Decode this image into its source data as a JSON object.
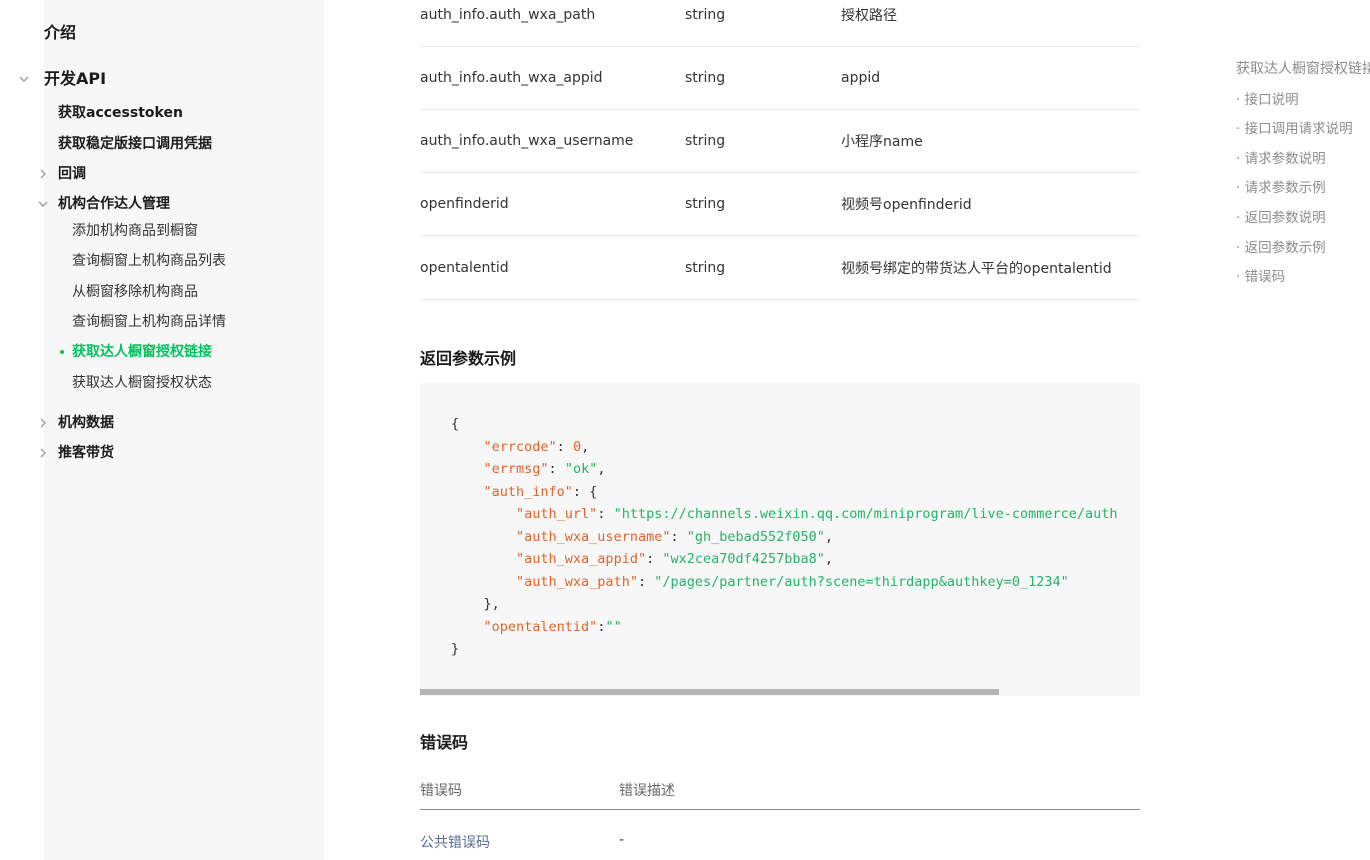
{
  "sidebar": {
    "intro": "介绍",
    "dev_api": "开发API",
    "items": [
      {
        "label": "获取accesstoken"
      },
      {
        "label": "获取稳定版接口调用凭据"
      },
      {
        "label": "回调"
      },
      {
        "label": "机构合作达人管理"
      },
      {
        "label": "添加机构商品到橱窗"
      },
      {
        "label": "查询橱窗上机构商品列表"
      },
      {
        "label": "从橱窗移除机构商品"
      },
      {
        "label": "查询橱窗上机构商品详情"
      },
      {
        "label": "获取达人橱窗授权链接"
      },
      {
        "label": "获取达人橱窗授权状态"
      },
      {
        "label": "机构数据"
      },
      {
        "label": "推客带货"
      }
    ]
  },
  "params": [
    {
      "name": "auth_info.auth_wxa_path",
      "type": "string",
      "desc": "授权路径"
    },
    {
      "name": "auth_info.auth_wxa_appid",
      "type": "string",
      "desc": "appid"
    },
    {
      "name": "auth_info.auth_wxa_username",
      "type": "string",
      "desc": "小程序name"
    },
    {
      "name": "openfinderid",
      "type": "string",
      "desc": "视频号openfinderid"
    },
    {
      "name": "opentalentid",
      "type": "string",
      "desc": "视频号绑定的带货达人平台的opentalentid"
    }
  ],
  "sections": {
    "return_example": "返回参数示例",
    "error_codes": "错误码"
  },
  "code": {
    "errcode_key": "\"errcode\"",
    "errcode_val": "0",
    "errmsg_key": "\"errmsg\"",
    "errmsg_val": "\"ok\"",
    "auth_info_key": "\"auth_info\"",
    "auth_url_key": "\"auth_url\"",
    "auth_url_val": "\"https://channels.weixin.qq.com/miniprogram/live-commerce/auth",
    "username_key": "\"auth_wxa_username\"",
    "username_val": "\"gh_bebad552f050\"",
    "appid_key": "\"auth_wxa_appid\"",
    "appid_val": "\"wx2cea70df4257bba8\"",
    "path_key": "\"auth_wxa_path\"",
    "path_val": "\"/pages/partner/auth?scene=thirdapp&authkey=0_1234\"",
    "talent_key": "\"opentalentid\"",
    "talent_val": "\"\""
  },
  "error_table": {
    "headers": [
      "错误码",
      "错误描述"
    ],
    "rows": [
      {
        "code": "公共错误码",
        "desc": "-"
      }
    ]
  },
  "toc": {
    "title": "获取达人橱窗授权链接",
    "items": [
      "· 接口说明",
      "· 接口调用请求说明",
      "· 请求参数说明",
      "· 请求参数示例",
      "· 返回参数说明",
      "· 返回参数示例",
      "· 错误码"
    ]
  },
  "colors": {
    "accent": "#07c160",
    "link": "#576b95",
    "code_key": "#e0652a",
    "code_string": "#25b26a"
  }
}
